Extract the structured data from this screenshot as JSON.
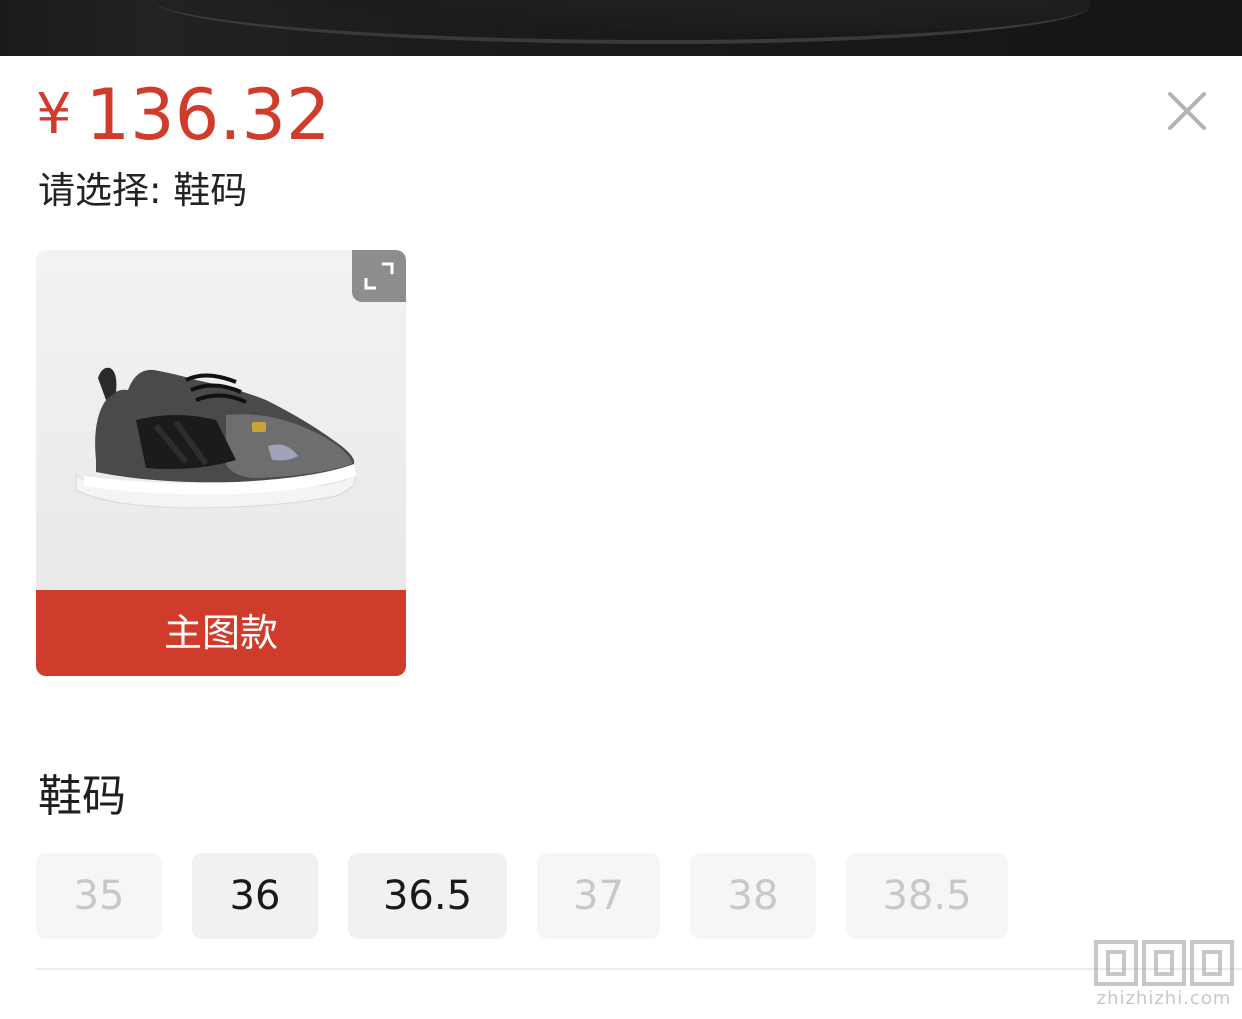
{
  "product": {
    "price_currency": "¥",
    "price_value": "136.32",
    "selection_prompt": "请选择: 鞋码"
  },
  "variant": {
    "label": "主图款",
    "image_icon": "shoe-photo",
    "expand_icon": "expand-icon"
  },
  "sizes": {
    "title": "鞋码",
    "options": [
      {
        "label": "35",
        "available": false
      },
      {
        "label": "36",
        "available": true
      },
      {
        "label": "36.5",
        "available": true
      },
      {
        "label": "37",
        "available": false
      },
      {
        "label": "38",
        "available": false
      },
      {
        "label": "38.5",
        "available": false
      }
    ]
  },
  "watermark": {
    "text": "zhizhizhi.com"
  },
  "colors": {
    "accent": "#d03c2b",
    "unavailable_text": "#c8c8c8",
    "available_text": "#1a1a1a"
  }
}
